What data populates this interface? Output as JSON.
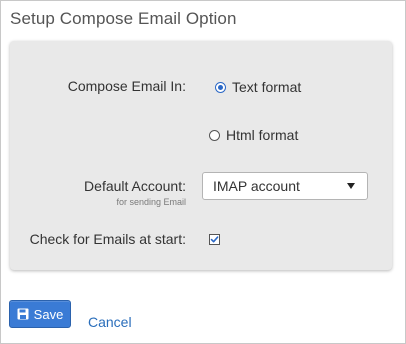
{
  "dialog": {
    "title": "Setup Compose Email Option"
  },
  "compose": {
    "label": "Compose Email In:",
    "options": [
      {
        "label": "Text format",
        "selected": true
      },
      {
        "label": "Html format",
        "selected": false
      }
    ]
  },
  "default_account": {
    "label": "Default Account:",
    "sublabel": "for sending Email",
    "selected_value": "IMAP account"
  },
  "check_at_start": {
    "label": "Check for Emails at start:",
    "checked": true
  },
  "actions": {
    "save_label": "Save",
    "cancel_label": "Cancel"
  },
  "colors": {
    "accent": "#3a7bd5",
    "link": "#2a6ebb",
    "panel_bg": "#e9e9e9"
  },
  "icons": {
    "save": "floppy-disk-icon",
    "dropdown": "caret-down-icon",
    "check": "checkmark-icon"
  }
}
